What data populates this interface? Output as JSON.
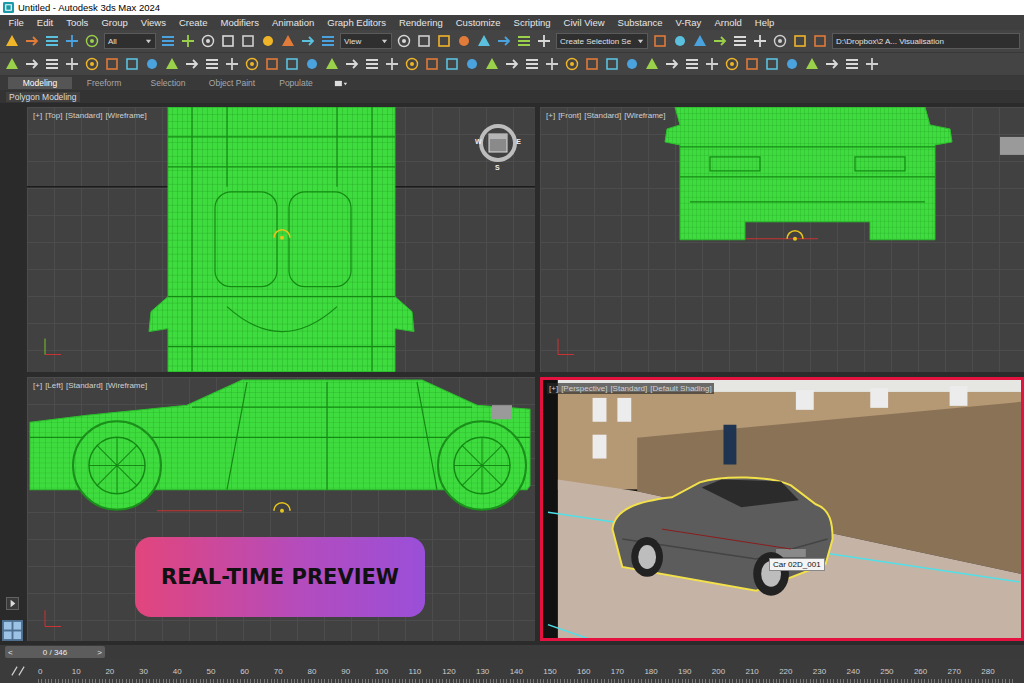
{
  "window": {
    "title": "Untitled - Autodesk 3ds Max 2024"
  },
  "menu": [
    "File",
    "Edit",
    "Tools",
    "Group",
    "Views",
    "Create",
    "Modifiers",
    "Animation",
    "Graph Editors",
    "Rendering",
    "Customize",
    "Scripting",
    "Civil View",
    "Substance",
    "V-Ray",
    "Arnold",
    "Help"
  ],
  "toolbar": {
    "selection_filter": "All",
    "reference_coordinate_system": "View",
    "named_selection_set": "Create Selection Se",
    "project_folder": "D:\\Dropbox\\2 A... Visualisation"
  },
  "ribbon": {
    "tabs": [
      {
        "label": "Modeling",
        "selected": true
      },
      {
        "label": "Freeform",
        "selected": false
      },
      {
        "label": "Selection",
        "selected": false
      },
      {
        "label": "Object Paint",
        "selected": false
      },
      {
        "label": "Populate",
        "selected": false
      }
    ],
    "panel": "Polygon Modeling"
  },
  "viewports": [
    {
      "kind": "top",
      "label": [
        "[+]",
        "[Top]",
        "[Standard]",
        "[Wireframe]"
      ],
      "active": false
    },
    {
      "kind": "front",
      "label": [
        "[+]",
        "[Front]",
        "[Standard]",
        "[Wireframe]"
      ],
      "active": false
    },
    {
      "kind": "left",
      "label": [
        "[+]",
        "[Left]",
        "[Standard]",
        "[Wireframe]"
      ],
      "active": false
    },
    {
      "kind": "perspective",
      "label": [
        "[+]",
        "[Perspective]",
        "[Standard]",
        "[Default Shading]"
      ],
      "active": true
    }
  ],
  "viewcube": {
    "labels": [
      "W",
      "E",
      "S"
    ]
  },
  "selected_object": {
    "label": "Car 02D_001"
  },
  "badge": {
    "text": "REAL-TIME PREVIEW"
  },
  "timeline": {
    "prev": "<",
    "position": "0 / 346",
    "next": ">",
    "level": 0,
    "ticks": [
      "0",
      "10",
      "20",
      "30",
      "40",
      "50",
      "60",
      "70",
      "80",
      "90",
      "100",
      "110",
      "120",
      "130",
      "140",
      "150",
      "160",
      "170",
      "180",
      "190",
      "200",
      "210",
      "220",
      "230",
      "240",
      "250",
      "260",
      "270",
      "280"
    ]
  }
}
